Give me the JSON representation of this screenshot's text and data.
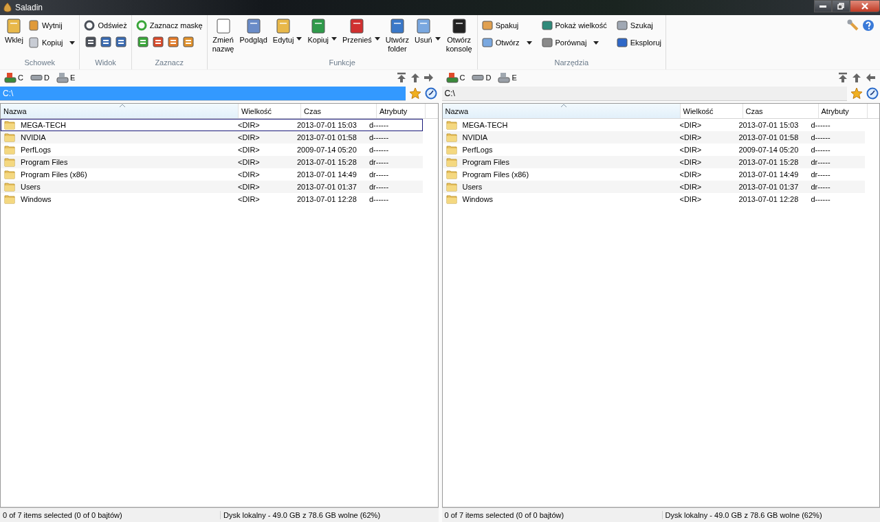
{
  "window": {
    "title": "Saladin"
  },
  "ribbon": [
    {
      "label": "Schowek",
      "kind": "stack",
      "items": [
        {
          "label": "Wklej",
          "kind": "large",
          "dropdown": false
        },
        {
          "label": "Wytnij",
          "kind": "small",
          "dropdown": false
        },
        {
          "label": "Kopiuj",
          "kind": "small",
          "dropdown": true
        }
      ]
    },
    {
      "label": "Widok",
      "kind": "toolbar",
      "items": [
        {
          "label": "Odśwież",
          "kind": "small",
          "dropdown": false
        }
      ]
    },
    {
      "label": "Zaznacz",
      "kind": "toolbar",
      "items": [
        {
          "label": "Zaznacz maskę",
          "kind": "small",
          "dropdown": false
        }
      ]
    },
    {
      "label": "Funkcje",
      "kind": "row",
      "items": [
        {
          "label": "Zmień\nnazwę",
          "kind": "large",
          "dropdown": false
        },
        {
          "label": "Podgląd",
          "kind": "large",
          "dropdown": false
        },
        {
          "label": "Edytuj",
          "kind": "large",
          "dropdown": true
        },
        {
          "label": "Kopiuj",
          "kind": "large",
          "dropdown": true
        },
        {
          "label": "Przenieś",
          "kind": "large",
          "dropdown": true
        },
        {
          "label": "Utwórz\nfolder",
          "kind": "large",
          "dropdown": false
        },
        {
          "label": "Usuń",
          "kind": "large",
          "dropdown": true
        },
        {
          "label": "Otwórz\nkonsolę",
          "kind": "large",
          "dropdown": false
        }
      ]
    },
    {
      "label": "Narzędzia",
      "kind": "grid",
      "items": [
        {
          "label": "Spakuj",
          "kind": "small",
          "dropdown": false
        },
        {
          "label": "Pokaż wielkość",
          "kind": "small",
          "dropdown": false
        },
        {
          "label": "Szukaj",
          "kind": "small",
          "dropdown": false
        },
        {
          "label": "Otwórz",
          "kind": "small",
          "dropdown": true
        },
        {
          "label": "Porównaj",
          "kind": "small",
          "dropdown": true
        },
        {
          "label": "Eksploruj",
          "kind": "small",
          "dropdown": false
        }
      ]
    }
  ],
  "panels": [
    {
      "drives": [
        "C",
        "D",
        "E"
      ],
      "path": "C:\\",
      "active": true,
      "columns": [
        {
          "label": "Nazwa",
          "sorted": true
        },
        {
          "label": "Wielkość",
          "sorted": false
        },
        {
          "label": "Czas",
          "sorted": false
        },
        {
          "label": "Atrybuty",
          "sorted": false
        }
      ],
      "rows": [
        {
          "name": "MEGA-TECH",
          "size": "<DIR>",
          "time": "2013-07-01 15:03",
          "attributes": "d------",
          "focused": true
        },
        {
          "name": "NVIDIA",
          "size": "<DIR>",
          "time": "2013-07-01 01:58",
          "attributes": "d------",
          "focused": false
        },
        {
          "name": "PerfLogs",
          "size": "<DIR>",
          "time": "2009-07-14 05:20",
          "attributes": "d------",
          "focused": false
        },
        {
          "name": "Program Files",
          "size": "<DIR>",
          "time": "2013-07-01 15:28",
          "attributes": "dr-----",
          "focused": false
        },
        {
          "name": "Program Files (x86)",
          "size": "<DIR>",
          "time": "2013-07-01 14:49",
          "attributes": "dr-----",
          "focused": false
        },
        {
          "name": "Users",
          "size": "<DIR>",
          "time": "2013-07-01 01:37",
          "attributes": "dr-----",
          "focused": false
        },
        {
          "name": "Windows",
          "size": "<DIR>",
          "time": "2013-07-01 12:28",
          "attributes": "d------",
          "focused": false
        }
      ],
      "status": {
        "selection": "0 of 7 items selected (0 of 0 bajtów)",
        "disk": "Dysk lokalny - 49.0 GB z 78.6 GB wolne (62%)"
      }
    },
    {
      "drives": [
        "C",
        "D",
        "E"
      ],
      "path": "C:\\",
      "active": false,
      "columns": [
        {
          "label": "Nazwa",
          "sorted": true
        },
        {
          "label": "Wielkość",
          "sorted": false
        },
        {
          "label": "Czas",
          "sorted": false
        },
        {
          "label": "Atrybuty",
          "sorted": false
        }
      ],
      "rows": [
        {
          "name": "MEGA-TECH",
          "size": "<DIR>",
          "time": "2013-07-01 15:03",
          "attributes": "d------",
          "focused": false
        },
        {
          "name": "NVIDIA",
          "size": "<DIR>",
          "time": "2013-07-01 01:58",
          "attributes": "d------",
          "focused": false
        },
        {
          "name": "PerfLogs",
          "size": "<DIR>",
          "time": "2009-07-14 05:20",
          "attributes": "d------",
          "focused": false
        },
        {
          "name": "Program Files",
          "size": "<DIR>",
          "time": "2013-07-01 15:28",
          "attributes": "dr-----",
          "focused": false
        },
        {
          "name": "Program Files (x86)",
          "size": "<DIR>",
          "time": "2013-07-01 14:49",
          "attributes": "dr-----",
          "focused": false
        },
        {
          "name": "Users",
          "size": "<DIR>",
          "time": "2013-07-01 01:37",
          "attributes": "dr-----",
          "focused": false
        },
        {
          "name": "Windows",
          "size": "<DIR>",
          "time": "2013-07-01 12:28",
          "attributes": "d------",
          "focused": false
        }
      ],
      "status": {
        "selection": "0 of 7 items selected (0 of 0 bajtów)",
        "disk": "Dysk lokalny - 49.0 GB z 78.6 GB wolne (62%)"
      }
    }
  ]
}
